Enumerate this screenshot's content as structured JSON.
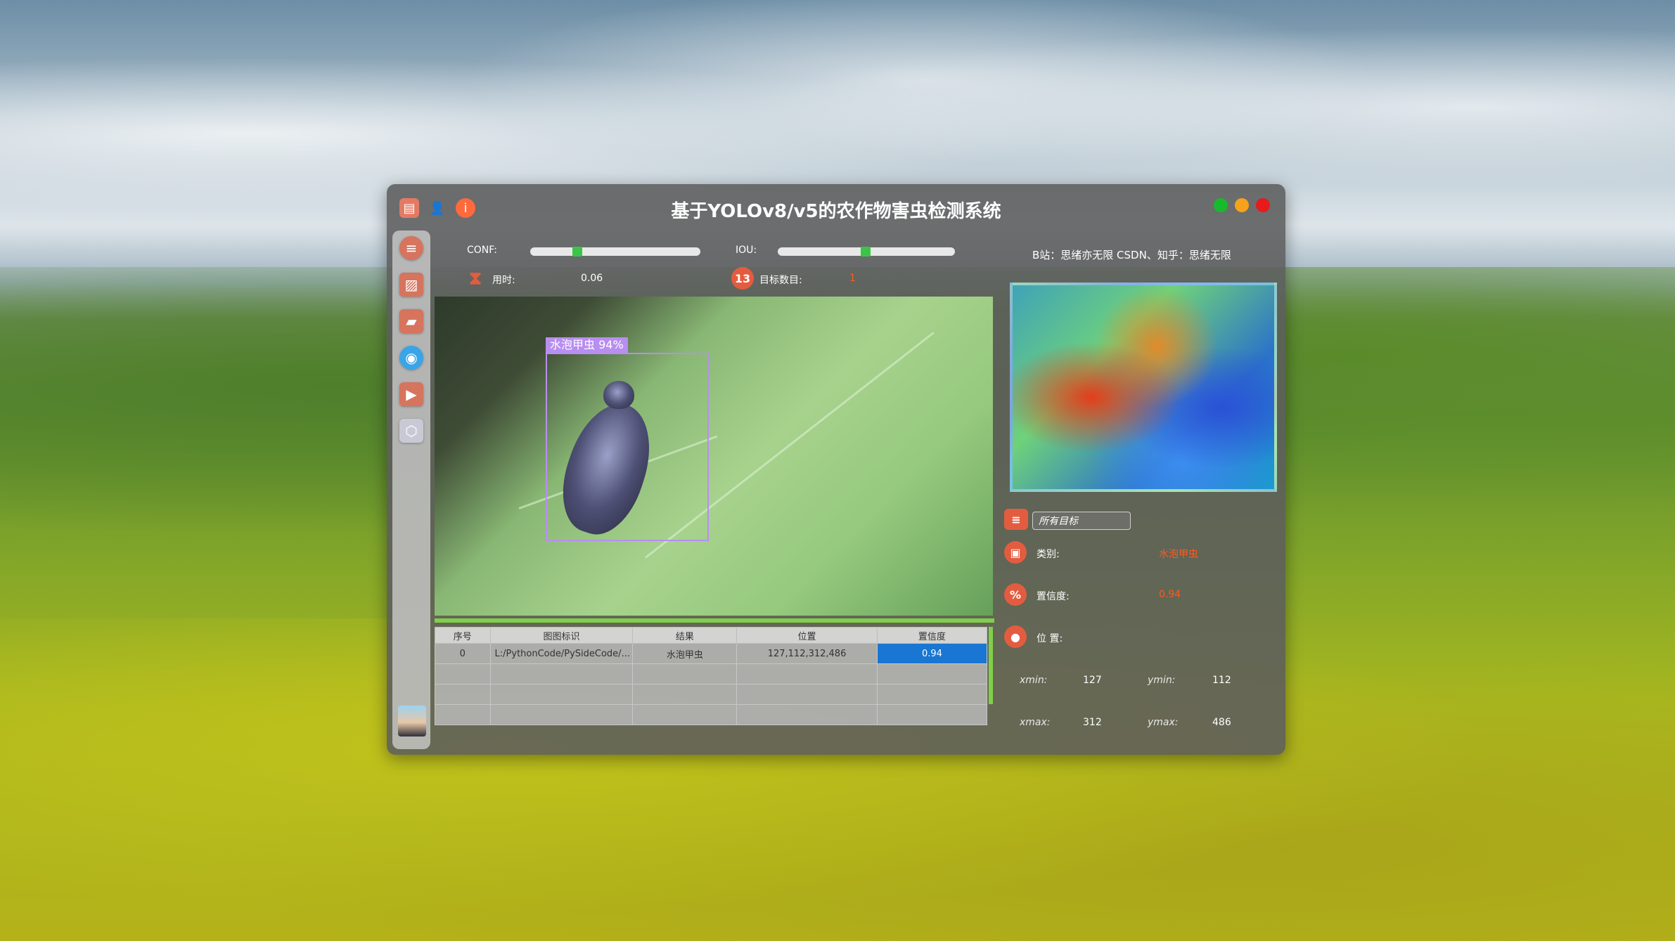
{
  "window": {
    "title": "基于YOLOv8/v5的农作物害虫检测系统"
  },
  "params": {
    "conf_label": "CONF:",
    "iou_label": "IOU:",
    "time_label": "用时:",
    "time_value": "0.06",
    "count_label": "目标数目:",
    "count_value": "1",
    "credits": "B站：思绪亦无限  CSDN、知乎：思绪无限"
  },
  "detection": {
    "box_label": "水泡甲虫 94%"
  },
  "table": {
    "headers": [
      "序号",
      "图图标识",
      "结果",
      "位置",
      "置信度"
    ],
    "rows": [
      [
        "0",
        "L:/PythonCode/PySideCode/...",
        "水泡甲虫",
        "127,112,312,486",
        "0.94"
      ]
    ]
  },
  "details": {
    "filter_placeholder": "所有目标",
    "class_label": "类别:",
    "class_value": "水泡甲虫",
    "conf_label": "置信度:",
    "conf_value": "0.94",
    "pos_label": "位 置:",
    "xmin_label": "xmin:",
    "xmin": "127",
    "ymin_label": "ymin:",
    "ymin": "112",
    "xmax_label": "xmax:",
    "xmax": "312",
    "ymax_label": "ymax:",
    "ymax": "486"
  }
}
